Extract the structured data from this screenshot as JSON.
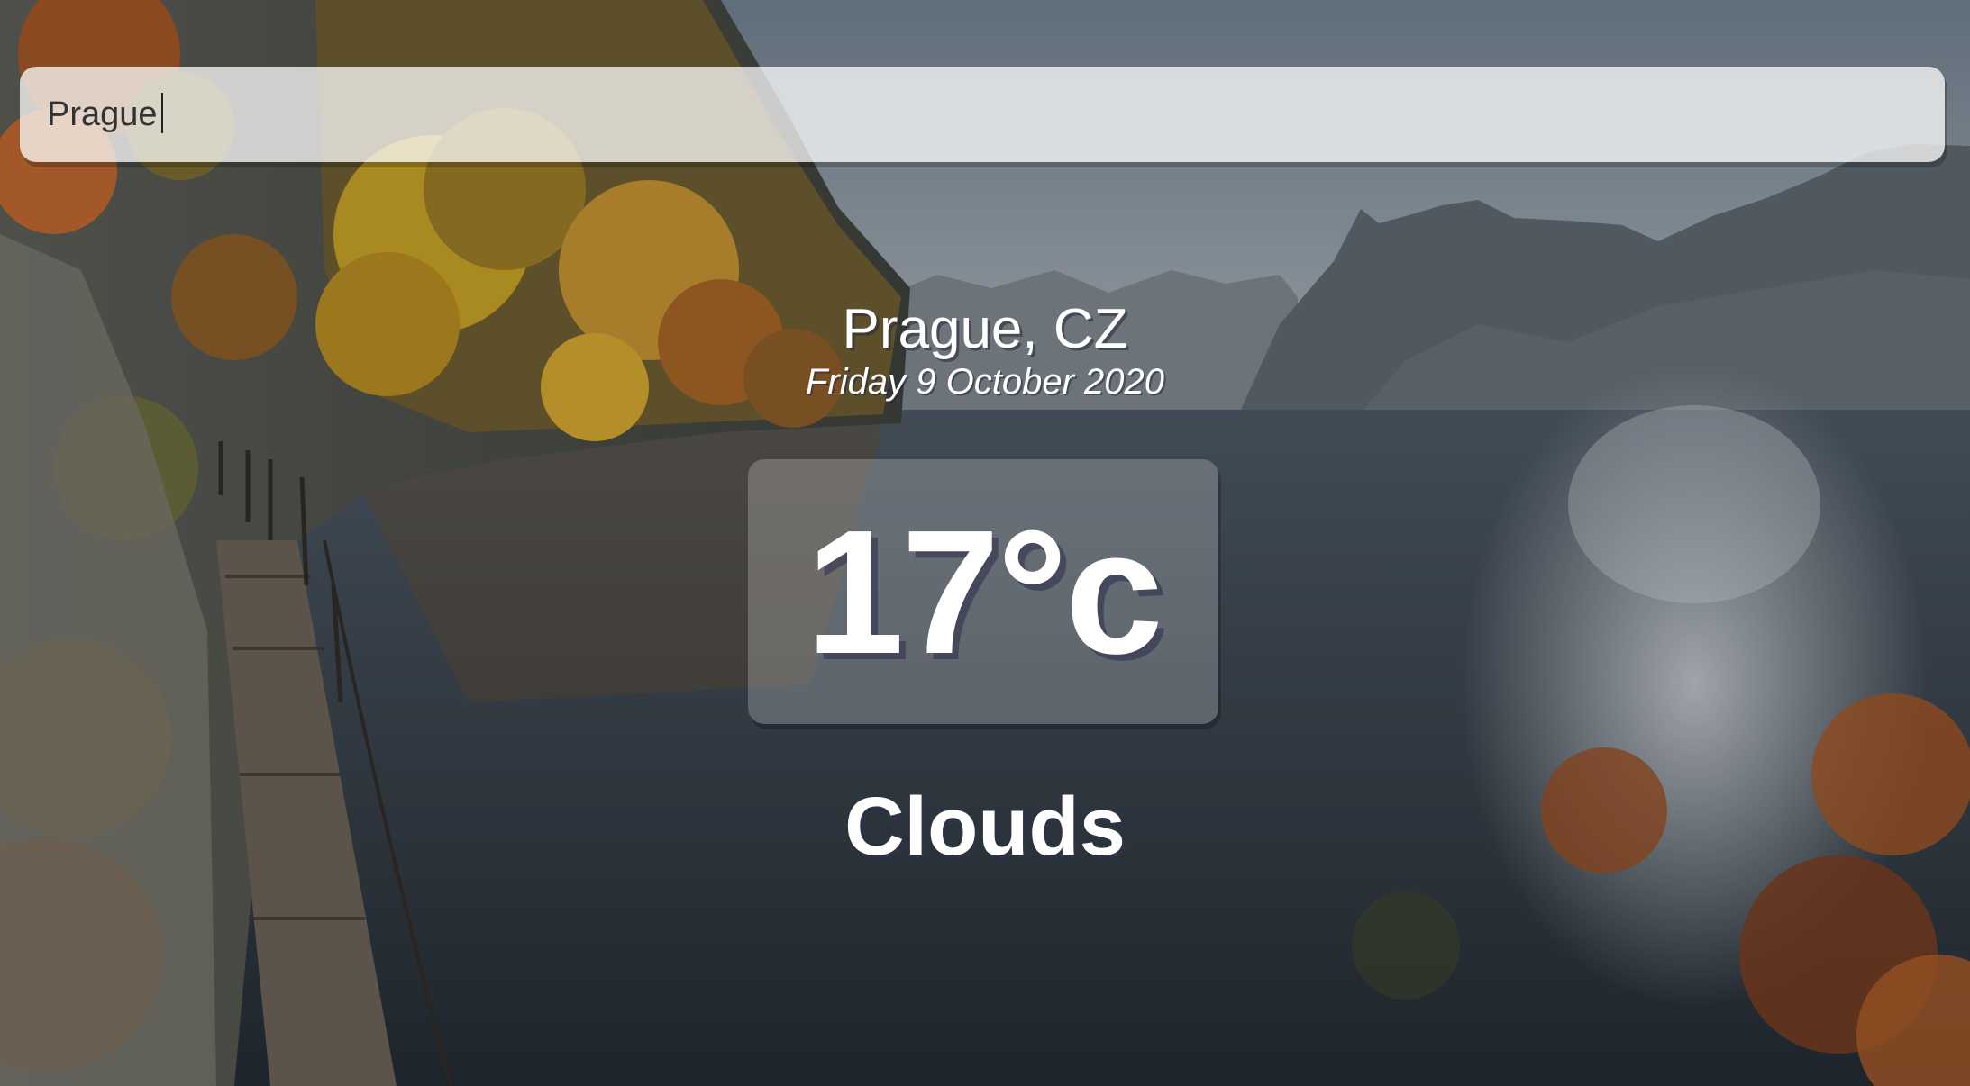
{
  "search": {
    "value": "Prague"
  },
  "weather": {
    "location": "Prague, CZ",
    "date": "Friday 9 October 2020",
    "temperature": "17°c",
    "condition": "Clouds"
  },
  "background": {
    "sky": "#9aa4ac",
    "water": "#2e3a44",
    "foliage": "#c8931e"
  }
}
